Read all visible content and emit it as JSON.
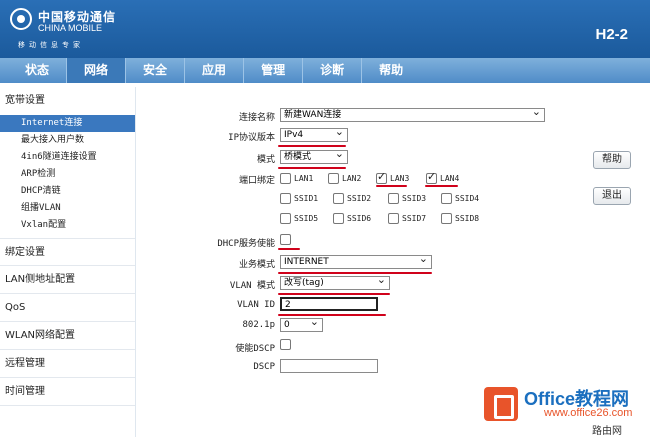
{
  "header": {
    "brand_cn": "中国移动通信",
    "brand_en": "CHINA MOBILE",
    "brand_sub": "移动信息专家",
    "model": "H2-2",
    "bg_color": "#1b5a9c"
  },
  "nav": {
    "items": [
      "状态",
      "网络",
      "安全",
      "应用",
      "管理",
      "诊断",
      "帮助"
    ],
    "active": "网络"
  },
  "sidebar": {
    "broadband": "宽带设置",
    "sub_items": [
      "Internet连接",
      "最大接入用户数",
      "4in6隧道连接设置",
      "ARP检测",
      "DHCP清链",
      "组播VLAN",
      "Vxlan配置"
    ],
    "active_sub": "Internet连接",
    "groups": [
      "绑定设置",
      "LAN侧地址配置",
      "QoS",
      "WLAN网络配置",
      "远程管理",
      "时间管理"
    ]
  },
  "form": {
    "connection_name_label": "连接名称",
    "connection_name": "新建WAN连接",
    "ip_version_label": "IP协议版本",
    "ip_version": "IPv4",
    "mode_label": "模式",
    "mode": "桥模式",
    "port_bind_label": "端口绑定",
    "ports": [
      {
        "label": "LAN1",
        "checked": false
      },
      {
        "label": "LAN2",
        "checked": false
      },
      {
        "label": "LAN3",
        "checked": true
      },
      {
        "label": "LAN4",
        "checked": true
      },
      {
        "label": "SSID1",
        "checked": false
      },
      {
        "label": "SSID2",
        "checked": false
      },
      {
        "label": "SSID3",
        "checked": false
      },
      {
        "label": "SSID4",
        "checked": false
      },
      {
        "label": "SSID5",
        "checked": false
      },
      {
        "label": "SSID6",
        "checked": false
      },
      {
        "label": "SSID7",
        "checked": false
      },
      {
        "label": "SSID8",
        "checked": false
      }
    ],
    "dhcp_label": "DHCP服务使能",
    "dhcp_enabled": false,
    "service_mode_label": "业务模式",
    "service_mode": "INTERNET",
    "vlan_mode_label": "VLAN 模式",
    "vlan_mode": "改写(tag)",
    "vlan_id_label": "VLAN ID",
    "vlan_id": "2",
    "p8021_label": "802.1p",
    "p8021": "0",
    "dscp_enable_label": "使能DSCP",
    "dscp_enabled": false,
    "dscp_label": "DSCP",
    "dscp_value": ""
  },
  "buttons": {
    "help": "帮助",
    "exit": "退出"
  },
  "watermark": {
    "title": "Office教程网",
    "url": "www.office26.com",
    "corner": "路由网"
  },
  "annotation_color": "#d0021b"
}
